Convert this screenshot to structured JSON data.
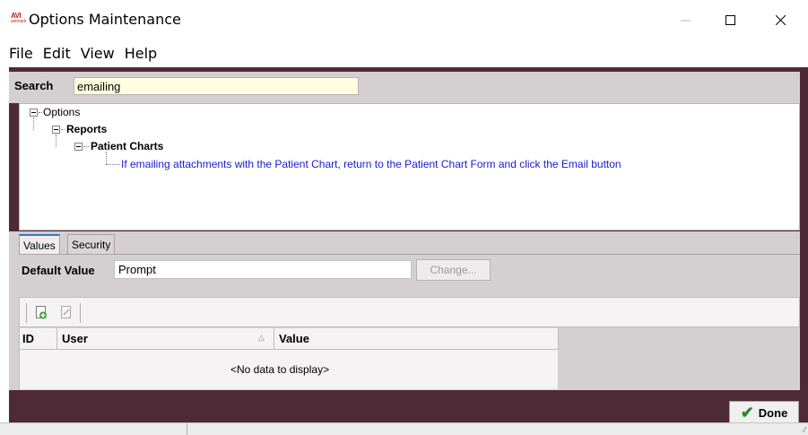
{
  "window": {
    "title": "Options Maintenance",
    "app_icon": "avi-logo-icon",
    "controls": [
      "minimize-icon",
      "maximize-icon",
      "close-icon"
    ]
  },
  "menu": [
    "File",
    "Edit",
    "View",
    "Help"
  ],
  "search": {
    "label": "Search",
    "value": "emailing"
  },
  "tree": {
    "root": "Options",
    "level1": "Reports",
    "level2": "Patient Charts",
    "leaf": "If emailing attachments with the Patient Chart, return to the Patient Chart Form and click the Email button"
  },
  "tabs": [
    {
      "label": "Values",
      "active": true
    },
    {
      "label": "Security",
      "active": false
    }
  ],
  "default_value": {
    "label": "Default Value",
    "value": "Prompt",
    "change_button": "Change..."
  },
  "grid": {
    "columns": [
      "ID",
      "User",
      "Value"
    ],
    "empty_text": "<No data to display>"
  },
  "done_button": "Done",
  "colors": {
    "frame": "#4e2a36",
    "panel": "#d4cfd0",
    "search_bg": "#ffffe0",
    "leaf_text": "#1a1ad0",
    "active_tab_accent": "#3a74c4"
  }
}
